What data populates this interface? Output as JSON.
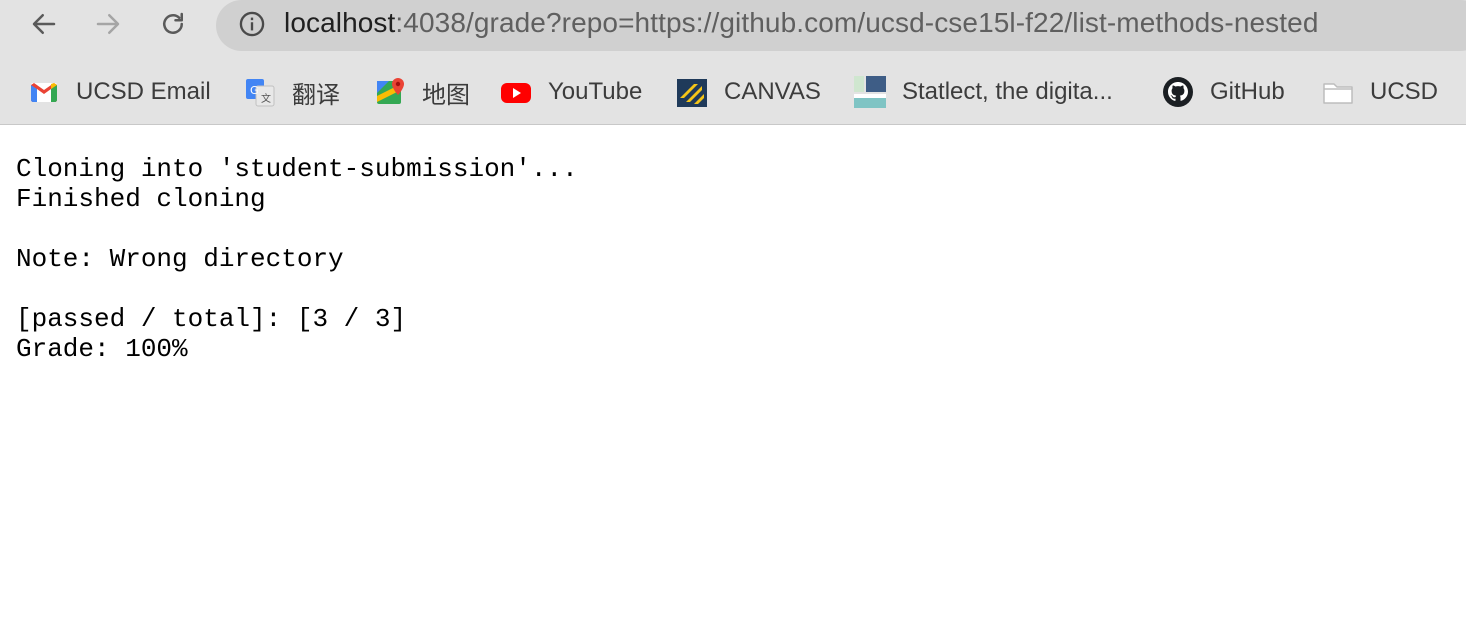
{
  "browser": {
    "url_host": "localhost",
    "url_rest": ":4038/grade?repo=https://github.com/ucsd-cse15l-f22/list-methods-nested",
    "bookmarks": [
      {
        "label": "UCSD Email",
        "icon": "gmail-icon"
      },
      {
        "label": "翻译",
        "icon": "google-translate-icon"
      },
      {
        "label": "地图",
        "icon": "google-maps-icon"
      },
      {
        "label": "YouTube",
        "icon": "youtube-icon"
      },
      {
        "label": "CANVAS",
        "icon": "canvas-icon"
      },
      {
        "label": "Statlect, the digita...",
        "icon": "statlect-icon"
      },
      {
        "label": "GitHub",
        "icon": "github-icon"
      },
      {
        "label": "UCSD",
        "icon": "folder-icon"
      }
    ]
  },
  "page": {
    "lines": [
      "Cloning into 'student-submission'...",
      "Finished cloning",
      "",
      "Note: Wrong directory",
      "",
      "[passed / total]: [3 / 3]",
      "Grade: 100%"
    ]
  },
  "colors": {
    "chrome_bg": "#e3e3e3",
    "omnibox_bg": "#d0d0d0",
    "youtube_red": "#ff0000",
    "canvas_navy": "#1f3a5a",
    "canvas_yellow": "#f5c518"
  }
}
